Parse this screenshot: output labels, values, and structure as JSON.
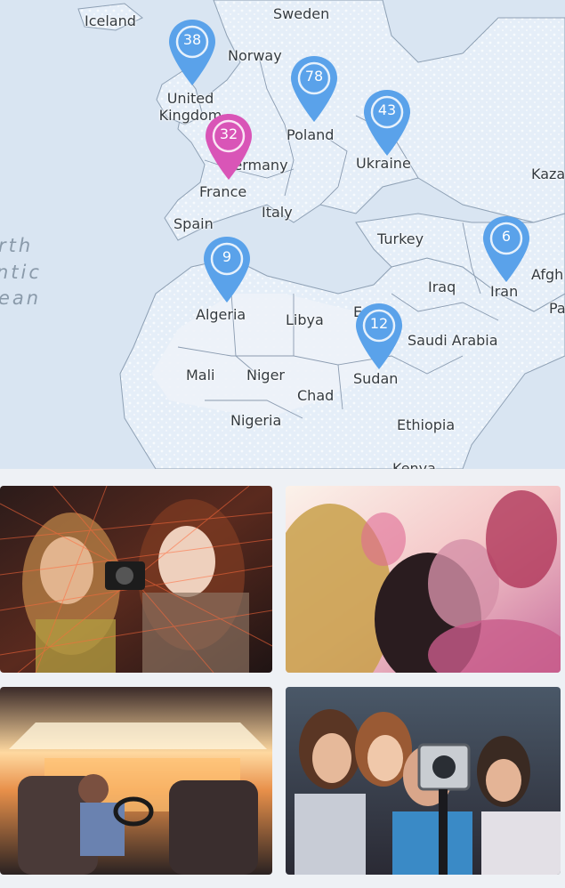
{
  "map": {
    "countries": [
      {
        "key": "iceland",
        "name": "Iceland"
      },
      {
        "key": "sweden",
        "name": "Sweden"
      },
      {
        "key": "norway",
        "name": "Norway"
      },
      {
        "key": "united-kingdom",
        "name": "United Kingdom"
      },
      {
        "key": "poland",
        "name": "Poland"
      },
      {
        "key": "germany",
        "name": "Germany"
      },
      {
        "key": "ukraine",
        "name": "Ukraine"
      },
      {
        "key": "kazakhstan",
        "name": "Kaza"
      },
      {
        "key": "france",
        "name": "France"
      },
      {
        "key": "italy",
        "name": "Italy"
      },
      {
        "key": "spain",
        "name": "Spain"
      },
      {
        "key": "turkey",
        "name": "Turkey"
      },
      {
        "key": "iraq",
        "name": "Iraq"
      },
      {
        "key": "iran",
        "name": "Iran"
      },
      {
        "key": "afghanistan",
        "name": "Afgh"
      },
      {
        "key": "pakistan",
        "name": "Pa"
      },
      {
        "key": "algeria",
        "name": "Algeria"
      },
      {
        "key": "libya",
        "name": "Libya"
      },
      {
        "key": "egypt",
        "name": "E"
      },
      {
        "key": "saudi-arabia",
        "name": "Saudi Arabia"
      },
      {
        "key": "mali",
        "name": "Mali"
      },
      {
        "key": "niger",
        "name": "Niger"
      },
      {
        "key": "chad",
        "name": "Chad"
      },
      {
        "key": "sudan",
        "name": "Sudan"
      },
      {
        "key": "nigeria",
        "name": "Nigeria"
      },
      {
        "key": "ethiopia",
        "name": "Ethiopia"
      },
      {
        "key": "kenya",
        "name": "Kenya"
      }
    ],
    "ocean_lines": [
      "rth",
      "ntic",
      "ean"
    ],
    "markers": [
      {
        "count": "38",
        "color": "#5aa2ea"
      },
      {
        "count": "78",
        "color": "#5aa2ea"
      },
      {
        "count": "43",
        "color": "#5aa2ea"
      },
      {
        "count": "32",
        "color": "#d955b7"
      },
      {
        "count": "9",
        "color": "#5aa2ea"
      },
      {
        "count": "6",
        "color": "#5aa2ea"
      },
      {
        "count": "12",
        "color": "#5aa2ea"
      }
    ]
  },
  "gallery": {
    "photos": [
      {
        "subject": "women-taking-selfie-photo"
      },
      {
        "subject": "festival-crowd-photo"
      },
      {
        "subject": "car-interior-sunset-photo"
      },
      {
        "subject": "group-with-action-camera-photo"
      }
    ]
  },
  "colors": {
    "marker_default": "#5aa2ea",
    "marker_selected": "#d955b7",
    "land": "#e4edf7",
    "sea": "#d8e5f2",
    "desert": "#eef3f8"
  }
}
